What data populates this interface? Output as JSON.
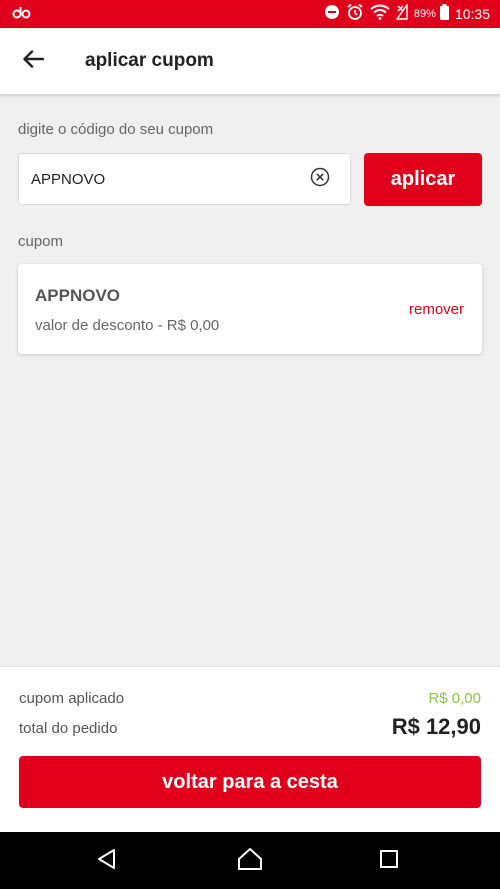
{
  "status_bar": {
    "battery": "89%",
    "time": "10:35",
    "icons": [
      "app-logo-icon",
      "do-not-disturb-icon",
      "alarm-icon",
      "wifi-icon",
      "no-signal-icon",
      "battery-icon"
    ]
  },
  "header": {
    "title": "aplicar cupom",
    "back_icon": "arrow-left-icon"
  },
  "coupon_form": {
    "label": "digite o código do seu cupom",
    "input_value": "APPNOVO",
    "apply_label": "aplicar"
  },
  "applied_coupon": {
    "section_label": "cupom",
    "code": "APPNOVO",
    "discount_text": "valor de desconto - R$ 0,00",
    "remove_label": "remover"
  },
  "summary": {
    "applied_label": "cupom aplicado",
    "applied_value": "R$ 0,00",
    "total_label": "total do pedido",
    "total_value": "R$ 12,90",
    "back_button_label": "voltar para a cesta"
  },
  "colors": {
    "brand_red": "#e0001b",
    "discount_green": "#8cc63f"
  }
}
